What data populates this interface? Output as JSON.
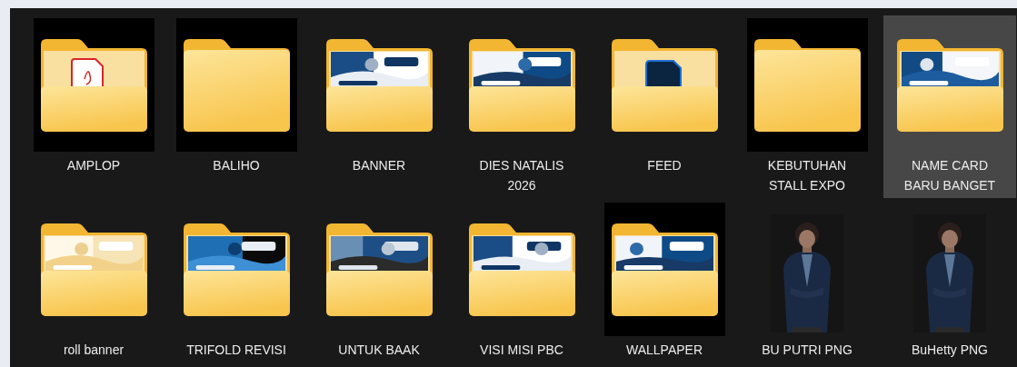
{
  "items": [
    {
      "kind": "pdffolder",
      "label": "AMPLOP",
      "selected": false,
      "backdrop": true
    },
    {
      "kind": "emptyfolder",
      "label": "BALIHO",
      "selected": false,
      "backdrop": true
    },
    {
      "kind": "picturefolder",
      "label": "BANNER",
      "selected": false,
      "backdrop": false
    },
    {
      "kind": "picturefolder",
      "label": "DIES NATALIS 2026",
      "selected": false,
      "backdrop": false
    },
    {
      "kind": "psfolder",
      "label": "FEED",
      "selected": false,
      "backdrop": false
    },
    {
      "kind": "emptyfolder",
      "label": "KEBUTUHAN STALL EXPO",
      "selected": false,
      "backdrop": true
    },
    {
      "kind": "picturefolder",
      "label": "NAME CARD BARU BANGET",
      "selected": true,
      "backdrop": false
    },
    {
      "kind": "picturefolder",
      "label": "roll banner",
      "selected": false,
      "backdrop": false
    },
    {
      "kind": "picturefolder",
      "label": "TRIFOLD REVISI",
      "selected": false,
      "backdrop": false
    },
    {
      "kind": "picturefolder",
      "label": "UNTUK BAAK",
      "selected": false,
      "backdrop": false
    },
    {
      "kind": "picturefolder",
      "label": "VISI MISI PBC",
      "selected": false,
      "backdrop": false
    },
    {
      "kind": "picturefolder",
      "label": "WALLPAPER",
      "selected": false,
      "backdrop": true
    },
    {
      "label": "BU PUTRI PNG",
      "selected": false
    },
    {
      "label": "BuHetty PNG",
      "selected": false
    }
  ]
}
